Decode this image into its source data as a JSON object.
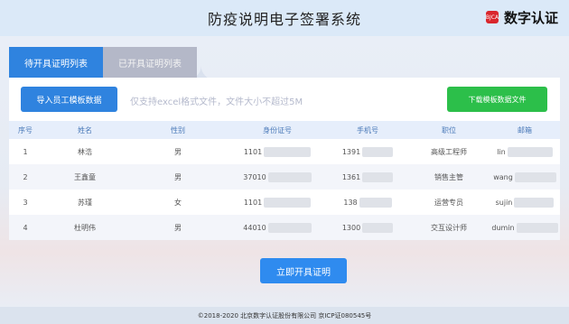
{
  "header": {
    "title": "防疫说明电子签署系统",
    "brand_mark": "BJCA",
    "brand_name": "数字认证"
  },
  "tabs": [
    {
      "label": "待开具证明列表",
      "active": true
    },
    {
      "label": "已开具证明列表",
      "active": false
    }
  ],
  "toolbar": {
    "import_label": "导入员工模板数据",
    "hint": "仅支持excel格式文件，文件大小不超过5M",
    "download_label": "下载模板数据文件"
  },
  "table": {
    "headers": [
      "序号",
      "姓名",
      "性别",
      "身份证号",
      "手机号",
      "职位",
      "邮箱"
    ],
    "rows": [
      {
        "index": "1",
        "name": "林浩",
        "gender": "男",
        "id_visible": "1101",
        "phone_visible": "1391",
        "position": "高级工程师",
        "email_visible": "lin"
      },
      {
        "index": "2",
        "name": "王鑫童",
        "gender": "男",
        "id_visible": "37010",
        "phone_visible": "1361",
        "position": "销售主管",
        "email_visible": "wang"
      },
      {
        "index": "3",
        "name": "苏瑾",
        "gender": "女",
        "id_visible": "1101",
        "phone_visible": "138",
        "position": "运营专员",
        "email_visible": "sujin"
      },
      {
        "index": "4",
        "name": "杜明伟",
        "gender": "男",
        "id_visible": "44010",
        "phone_visible": "1300",
        "position": "交互设计师",
        "email_visible": "dumin"
      }
    ]
  },
  "actions": {
    "issue_label": "立即开具证明"
  },
  "footer": {
    "text": "©2018-2020 北京数字认证股份有限公司 京ICP证080545号"
  },
  "colors": {
    "primary": "#2f83df",
    "success": "#2cbf4a",
    "tab_inactive": "#b4b8c8",
    "brand_red": "#d9262c"
  }
}
